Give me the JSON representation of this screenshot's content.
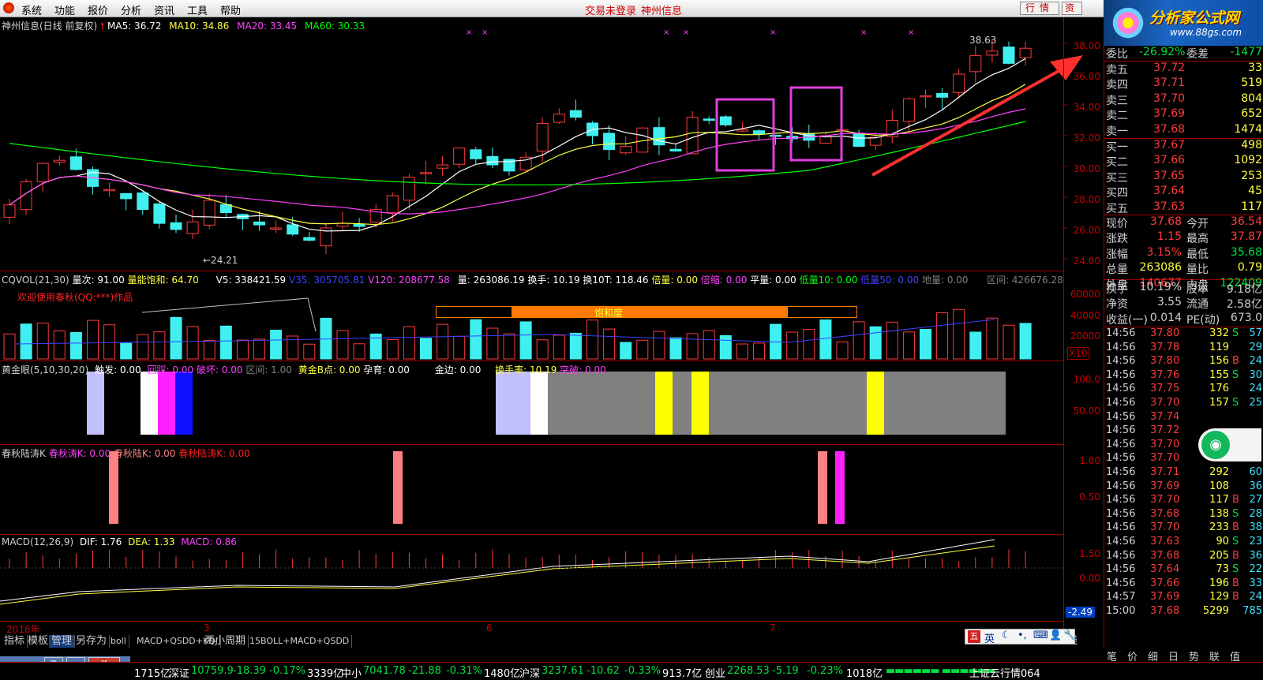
{
  "menu": {
    "items": [
      "系统",
      "功能",
      "报价",
      "分析",
      "资讯",
      "工具",
      "帮助"
    ],
    "center_left": "交易未登录",
    "center_right": "神州信息",
    "btn_quote": "行情",
    "btn_trade": "资"
  },
  "logo": {
    "title": "分析家公式网",
    "url": "www.88gs.com"
  },
  "main": {
    "stock": "神州信息(日线 前复权)",
    "ma5": "MA5: 36.72",
    "ma10": "MA10: 34.86",
    "ma20": "MA20: 33.45",
    "ma60": "MA60: 30.33",
    "high_label": "38.63",
    "low_label": "←24.21",
    "yticks": [
      "38.00",
      "36.00",
      "34.00",
      "32.00",
      "30.00",
      "28.00",
      "26.00",
      "24.00"
    ]
  },
  "vol": {
    "name": "CQVOL(21,30)",
    "v1": "量次: 91.00",
    "v2": "量能饱和: 64.70",
    "v3": "V5: 338421.59",
    "v4": "V35: 305705.81",
    "v5": "V120: 208677.58",
    "v6": "量: 263086.19",
    "v7": "换手: 10.19",
    "v8": "换10T: 118.46",
    "v9": "倍量: 0.00",
    "v10": "倍缩: 0.00",
    "v11": "平量: 0.00",
    "v12": "低量10: 0.00",
    "v13": "低量50: 0.00",
    "v14": "地量: 0.00",
    "v15": "区间: 426676.28",
    "welcome": "欢迎使用春秋(QQ:***)作品",
    "saturation": "饱和度",
    "yticks": [
      "60000",
      "40000",
      "20000"
    ],
    "x10": "X10"
  },
  "gold": {
    "name": "黄金眼(5,10,30,20)",
    "a": "触发: 0.00",
    "b": "回踩: 0.00",
    "c": "破坏: 0.00",
    "d": "区间: 1.00",
    "e": "黄金B点: 0.00",
    "f": "孕育: 0.00",
    "g": "金边: 0.00",
    "h": "换手率: 10.19",
    "i": "突破: 0.00",
    "yticks": [
      "100.0",
      "50.00"
    ]
  },
  "spring": {
    "name": "春秋陆涛K",
    "a": "春秋涛K: 0.00",
    "b": "春秋陆K: 0.00",
    "c": "春秋陆涛K: 0.00",
    "yticks": [
      "1.00",
      "0.50"
    ]
  },
  "macd": {
    "name": "MACD(12,26,9)",
    "dif": "DIF: 1.76",
    "dea": "DEA: 1.33",
    "macd": "MACD: 0.86",
    "yticks": [
      "1.50",
      "0.00"
    ],
    "last": "-2.49"
  },
  "xaxis": {
    "year": "2016年",
    "m3": "3",
    "m6": "6",
    "m7": "7"
  },
  "tabs": [
    "指标",
    "模板",
    "管理",
    "另存为",
    "boll",
    "MACD+QSDD+KDJ",
    "两小周期",
    "15BOLL+MACD+QSDD"
  ],
  "tab_right": "日线",
  "quote": {
    "wb_label": "委比",
    "wb": "-26.92%",
    "wc_label": "委差",
    "wc": "-1477",
    "asks": [
      {
        "l": "卖五",
        "p": "37.72",
        "v": "33"
      },
      {
        "l": "卖四",
        "p": "37.71",
        "v": "519"
      },
      {
        "l": "卖三",
        "p": "37.70",
        "v": "804"
      },
      {
        "l": "卖二",
        "p": "37.69",
        "v": "652"
      },
      {
        "l": "卖一",
        "p": "37.68",
        "v": "1474"
      }
    ],
    "bids": [
      {
        "l": "买一",
        "p": "37.67",
        "v": "498"
      },
      {
        "l": "买二",
        "p": "37.66",
        "v": "1092"
      },
      {
        "l": "买三",
        "p": "37.65",
        "v": "253"
      },
      {
        "l": "买四",
        "p": "37.64",
        "v": "45"
      },
      {
        "l": "买五",
        "p": "37.63",
        "v": "117"
      }
    ],
    "stats": [
      {
        "a": "现价",
        "b": "37.68",
        "c": "今开",
        "d": "36.54"
      },
      {
        "a": "涨跌",
        "b": "1.15",
        "c": "最高",
        "d": "37.87"
      },
      {
        "a": "涨幅",
        "b": "3.15%",
        "c": "最低",
        "d": "35.68"
      },
      {
        "a": "总量",
        "b": "263086",
        "c": "量比",
        "d": "0.79"
      },
      {
        "a": "外盘",
        "b": "140677",
        "c": "内盘",
        "d": "122409"
      },
      {
        "a": "换手",
        "b": "10.19%",
        "c": "股本",
        "d": "9.18亿"
      },
      {
        "a": "净资",
        "b": "3.55",
        "c": "流通",
        "d": "2.58亿"
      },
      {
        "a": "收益(一)",
        "b": "0.014",
        "c": "PE(动)",
        "d": "673.0"
      }
    ],
    "ticks": [
      {
        "t": "14:56",
        "p": "37.80",
        "v": "332",
        "s": "S",
        "n": "57"
      },
      {
        "t": "14:56",
        "p": "37.78",
        "v": "119",
        "s": "",
        "n": "29"
      },
      {
        "t": "14:56",
        "p": "37.80",
        "v": "156",
        "s": "B",
        "n": "24"
      },
      {
        "t": "14:56",
        "p": "37.76",
        "v": "155",
        "s": "S",
        "n": "30"
      },
      {
        "t": "14:56",
        "p": "37.75",
        "v": "176",
        "s": "",
        "n": "24"
      },
      {
        "t": "14:56",
        "p": "37.70",
        "v": "157",
        "s": "S",
        "n": "25"
      },
      {
        "t": "14:56",
        "p": "37.74",
        "v": "",
        "s": "",
        "n": ""
      },
      {
        "t": "14:56",
        "p": "37.72",
        "v": "",
        "s": "",
        "n": ""
      },
      {
        "t": "14:56",
        "p": "37.70",
        "v": "97",
        "s": "S",
        "n": "27"
      },
      {
        "t": "14:56",
        "p": "37.70",
        "v": "109",
        "s": "S",
        "n": "20"
      },
      {
        "t": "14:56",
        "p": "37.71",
        "v": "292",
        "s": "",
        "n": "60"
      },
      {
        "t": "14:56",
        "p": "37.69",
        "v": "108",
        "s": "",
        "n": "36"
      },
      {
        "t": "14:56",
        "p": "37.70",
        "v": "117",
        "s": "B",
        "n": "27"
      },
      {
        "t": "14:56",
        "p": "37.68",
        "v": "138",
        "s": "S",
        "n": "28"
      },
      {
        "t": "14:56",
        "p": "37.70",
        "v": "233",
        "s": "B",
        "n": "38"
      },
      {
        "t": "14:56",
        "p": "37.63",
        "v": "90",
        "s": "S",
        "n": "23"
      },
      {
        "t": "14:56",
        "p": "37.68",
        "v": "205",
        "s": "B",
        "n": "36"
      },
      {
        "t": "14:56",
        "p": "37.64",
        "v": "73",
        "s": "S",
        "n": "22"
      },
      {
        "t": "14:56",
        "p": "37.66",
        "v": "196",
        "s": "B",
        "n": "33"
      },
      {
        "t": "14:57",
        "p": "37.69",
        "v": "129",
        "s": "B",
        "n": "24"
      },
      {
        "t": "15:00",
        "p": "37.68",
        "v": "5299",
        "s": "",
        "n": "785"
      }
    ],
    "nav": [
      "笔",
      "价",
      "细",
      "日",
      "势",
      "联",
      "值"
    ]
  },
  "status": {
    "s0": "1715亿",
    "s1": "深证",
    "s2": "10759.9",
    "s3": "-18.39",
    "s4": "-0.17%",
    "s5": "3339亿",
    "s6": "中小",
    "s7": "7041.78",
    "s8": "-21.88",
    "s9": "-0.31%",
    "s10": "1480亿",
    "s11": "沪深",
    "s12": "3237.61",
    "s13": "-10.62",
    "s14": "-0.33%",
    "s15": "913.7亿",
    "s16": "创业",
    "s17": "2268.53",
    "s18": "-5.19",
    "s19": "-0.23%",
    "s20": "1018亿",
    "s21": "上证云行情064"
  },
  "ime": {
    "a": "英"
  },
  "colors": {
    "up": "#ff3b3b",
    "down": "#40f0f0",
    "ma5": "#ffffff",
    "ma10": "#ffff40",
    "ma20": "#ff40ff",
    "ma60": "#00ff00",
    "grid": "#a00000",
    "box": "#e040e0",
    "arrow": "#ff3030"
  }
}
